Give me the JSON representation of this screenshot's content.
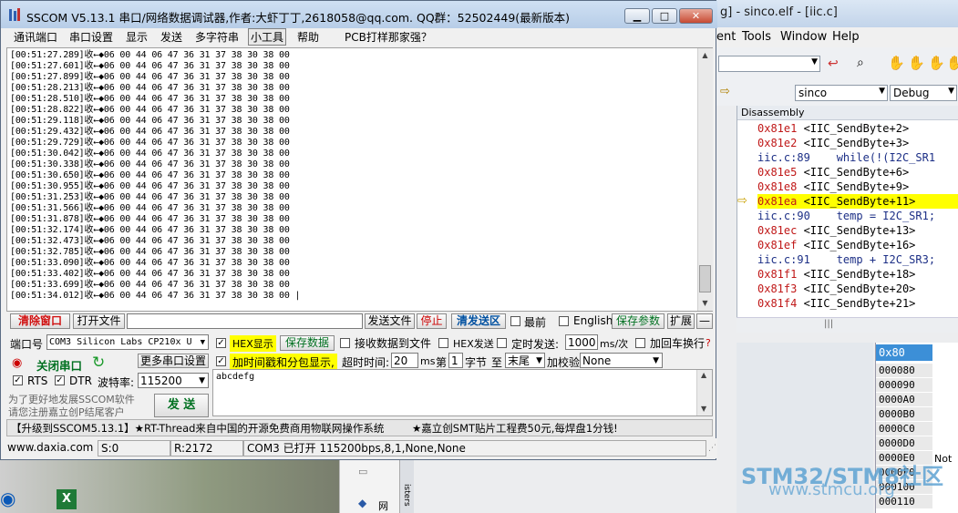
{
  "ide": {
    "title": "g] - sinco.elf - [iic.c]",
    "menu": [
      "ent",
      "Tools",
      "Window",
      "Help"
    ],
    "target_combo": "sinco",
    "config_combo": "Debug",
    "disassembly_header": "Disassembly",
    "disasm_lines": [
      {
        "addr": "0x81e1",
        "text": " <IIC_SendByte+2>",
        "src": false
      },
      {
        "addr": "0x81e2",
        "text": " <IIC_SendByte+3>",
        "src": false
      },
      {
        "addr": "iic.c:89",
        "text": "    while(!(I2C_SR1",
        "src": true
      },
      {
        "addr": "0x81e5",
        "text": " <IIC_SendByte+6>",
        "src": false
      },
      {
        "addr": "0x81e8",
        "text": " <IIC_SendByte+9>",
        "src": false
      },
      {
        "addr": "0x81ea",
        "text": " <IIC_SendByte+11>",
        "src": false,
        "current": true
      },
      {
        "addr": "iic.c:90",
        "text": "    temp = I2C_SR1;",
        "src": true
      },
      {
        "addr": "0x81ec",
        "text": " <IIC_SendByte+13>",
        "src": false
      },
      {
        "addr": "0x81ef",
        "text": " <IIC_SendByte+16>",
        "src": false
      },
      {
        "addr": "iic.c:91",
        "text": "    temp + I2C_SR3;",
        "src": true
      },
      {
        "addr": "0x81f1",
        "text": " <IIC_SendByte+18>",
        "src": false
      },
      {
        "addr": "0x81f3",
        "text": " <IIC_SendByte+20>",
        "src": false
      },
      {
        "addr": "0x81f4",
        "text": " <IIC_SendByte+21>",
        "src": false
      }
    ],
    "memory_addr": "0x80",
    "memory_rows": [
      "000080",
      "000090",
      "0000A0",
      "0000B0",
      "0000C0",
      "0000D0",
      "0000E0",
      "0000F0",
      "000100",
      "000110"
    ],
    "memory_note": "Not",
    "side_tab": "isters",
    "watermark": "STM32/STM8社区",
    "watermark_url": "www.stmcu.org"
  },
  "sscom": {
    "title": "SSCOM V5.13.1 串口/网络数据调试器,作者:大虾丁丁,2618058@qq.com. QQ群：52502449(最新版本)",
    "menu": [
      "通讯端口",
      "串口设置",
      "显示",
      "发送",
      "多字符串",
      "小工具",
      "帮助",
      "PCB打样那家强？"
    ],
    "received_lines": [
      "[00:51:27.289]收←◆06 00 44 06 47 36 31 37 38 30 38 00",
      "[00:51:27.601]收←◆06 00 44 06 47 36 31 37 38 30 38 00",
      "[00:51:27.899]收←◆06 00 44 06 47 36 31 37 38 30 38 00",
      "[00:51:28.213]收←◆06 00 44 06 47 36 31 37 38 30 38 00",
      "[00:51:28.510]收←◆06 00 44 06 47 36 31 37 38 30 38 00",
      "[00:51:28.822]收←◆06 00 44 06 47 36 31 37 38 30 38 00",
      "[00:51:29.118]收←◆06 00 44 06 47 36 31 37 38 30 38 00",
      "[00:51:29.432]收←◆06 00 44 06 47 36 31 37 38 30 38 00",
      "[00:51:29.729]收←◆06 00 44 06 47 36 31 37 38 30 38 00",
      "[00:51:30.042]收←◆06 00 44 06 47 36 31 37 38 30 38 00",
      "[00:51:30.338]收←◆06 00 44 06 47 36 31 37 38 30 38 00",
      "[00:51:30.650]收←◆06 00 44 06 47 36 31 37 38 30 38 00",
      "[00:51:30.955]收←◆06 00 44 06 47 36 31 37 38 30 38 00",
      "[00:51:31.253]收←◆06 00 44 06 47 36 31 37 38 30 38 00",
      "[00:51:31.566]收←◆06 00 44 06 47 36 31 37 38 30 38 00",
      "[00:51:31.878]收←◆06 00 44 06 47 36 31 37 38 30 38 00",
      "[00:51:32.174]收←◆06 00 44 06 47 36 31 37 38 30 38 00",
      "[00:51:32.473]收←◆06 00 44 06 47 36 31 37 38 30 38 00",
      "[00:51:32.785]收←◆06 00 44 06 47 36 31 37 38 30 38 00",
      "[00:51:33.090]收←◆06 00 44 06 47 36 31 37 38 30 38 00",
      "[00:51:33.402]收←◆06 00 44 06 47 36 31 37 38 30 38 00",
      "[00:51:33.699]收←◆06 00 44 06 47 36 31 37 38 30 38 00",
      "[00:51:34.012]收←◆06 00 44 06 47 36 31 37 38 30 38 00 |"
    ],
    "toolbar1": {
      "clear_window": "清除窗口",
      "open_file": "打开文件",
      "send_file": "发送文件",
      "stop": "停止",
      "clear_send": "清发送区",
      "topmost": "最前",
      "english": "English",
      "save_params": "保存参数",
      "expand": "扩展",
      "minus": "—"
    },
    "port": {
      "label": "端口号",
      "value": "COM3 Silicon Labs CP210x U",
      "close_btn": "关闭串口",
      "more_settings": "更多串口设置",
      "rts": "RTS",
      "dtr": "DTR",
      "baud_label": "波特率:",
      "baud_value": "115200"
    },
    "options": {
      "hex_display": "HEX显示",
      "save_data": "保存数据",
      "recv_to_file": "接收数据到文件",
      "hex_send": "HEX发送",
      "timed_send": "定时发送:",
      "interval": "1000",
      "interval_unit": "ms/次",
      "add_cr": "加回车换行",
      "timestamp": "加时间戳和分包显示,",
      "timeout_label": "超时时间:",
      "timeout": "20",
      "timeout_unit": "ms",
      "byte_prefix": "第",
      "byte_num": "1",
      "byte_label": "字节",
      "to": "至",
      "end": "末尾",
      "checksum_label": "加校验",
      "checksum": "None"
    },
    "send_text": "abcdefg",
    "send_button": "发 送",
    "promo_left": "为了更好地发展SSCOM软件\n请您注册嘉立创P结尾客户",
    "promo_bar_1": "【升级到SSCOM5.13.1】★RT-Thread来自中国的开源免费商用物联网操作系统",
    "promo_bar_2": "★嘉立创SMT贴片工程费50元,每焊盘1分钱!",
    "status": {
      "url": "www.daxia.com",
      "s": "S:0",
      "r": "R:2172",
      "port": "COM3 已打开  115200bps,8,1,None,None"
    }
  }
}
